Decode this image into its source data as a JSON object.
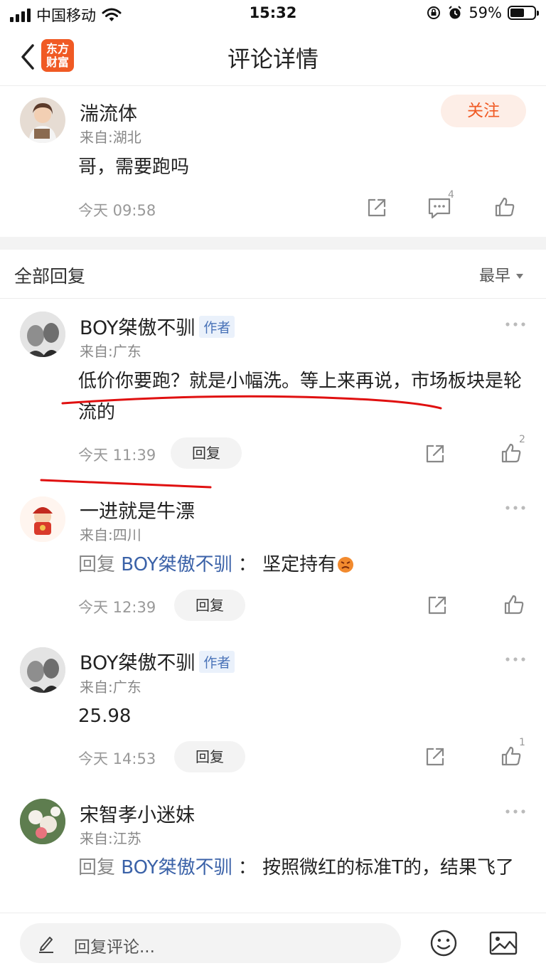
{
  "status_bar": {
    "carrier": "中国移动",
    "time": "15:32",
    "battery_percent": "59%",
    "battery_level": 0.59
  },
  "nav": {
    "title": "评论详情",
    "logo_line1": "东方",
    "logo_line2": "财富"
  },
  "main_comment": {
    "user": "湍流体",
    "from": "来自:湖北",
    "text": "哥，需要跑吗",
    "time": "今天 09:58",
    "follow_label": "关注",
    "comment_count": "4"
  },
  "replies_header": {
    "title": "全部回复",
    "sort_label": "最早"
  },
  "replies": [
    {
      "user": "BOY桀傲不驯",
      "author_tag": "作者",
      "from": "来自:广东",
      "text": "低价你要跑？就是小幅洗。等上来再说，市场板块是轮流的",
      "time": "今天 11:39",
      "reply_label": "回复",
      "like_count": "2"
    },
    {
      "user": "一进就是牛漂",
      "from": "来自:四川",
      "reply_prefix": "回复",
      "mention": "BOY桀傲不驯",
      "colon": "：",
      "text": "坚定持有",
      "time": "今天 12:39",
      "reply_label": "回复"
    },
    {
      "user": "BOY桀傲不驯",
      "author_tag": "作者",
      "from": "来自:广东",
      "text": "25.98",
      "time": "今天 14:53",
      "reply_label": "回复",
      "like_count": "1"
    },
    {
      "user": "宋智孝小迷妹",
      "from": "来自:江苏",
      "reply_prefix": "回复",
      "mention": "BOY桀傲不驯",
      "colon": "：",
      "text": "按照微红的标准T的，结果飞了"
    }
  ],
  "bottom_bar": {
    "placeholder": "回复评论..."
  },
  "colors": {
    "accent": "#f05a24",
    "mention": "#3b62a8",
    "annotation": "#e01010"
  },
  "icons": [
    "back-icon",
    "share-icon",
    "comment-icon",
    "like-icon",
    "more-icon",
    "emoji-icon",
    "image-icon",
    "pencil-icon"
  ]
}
